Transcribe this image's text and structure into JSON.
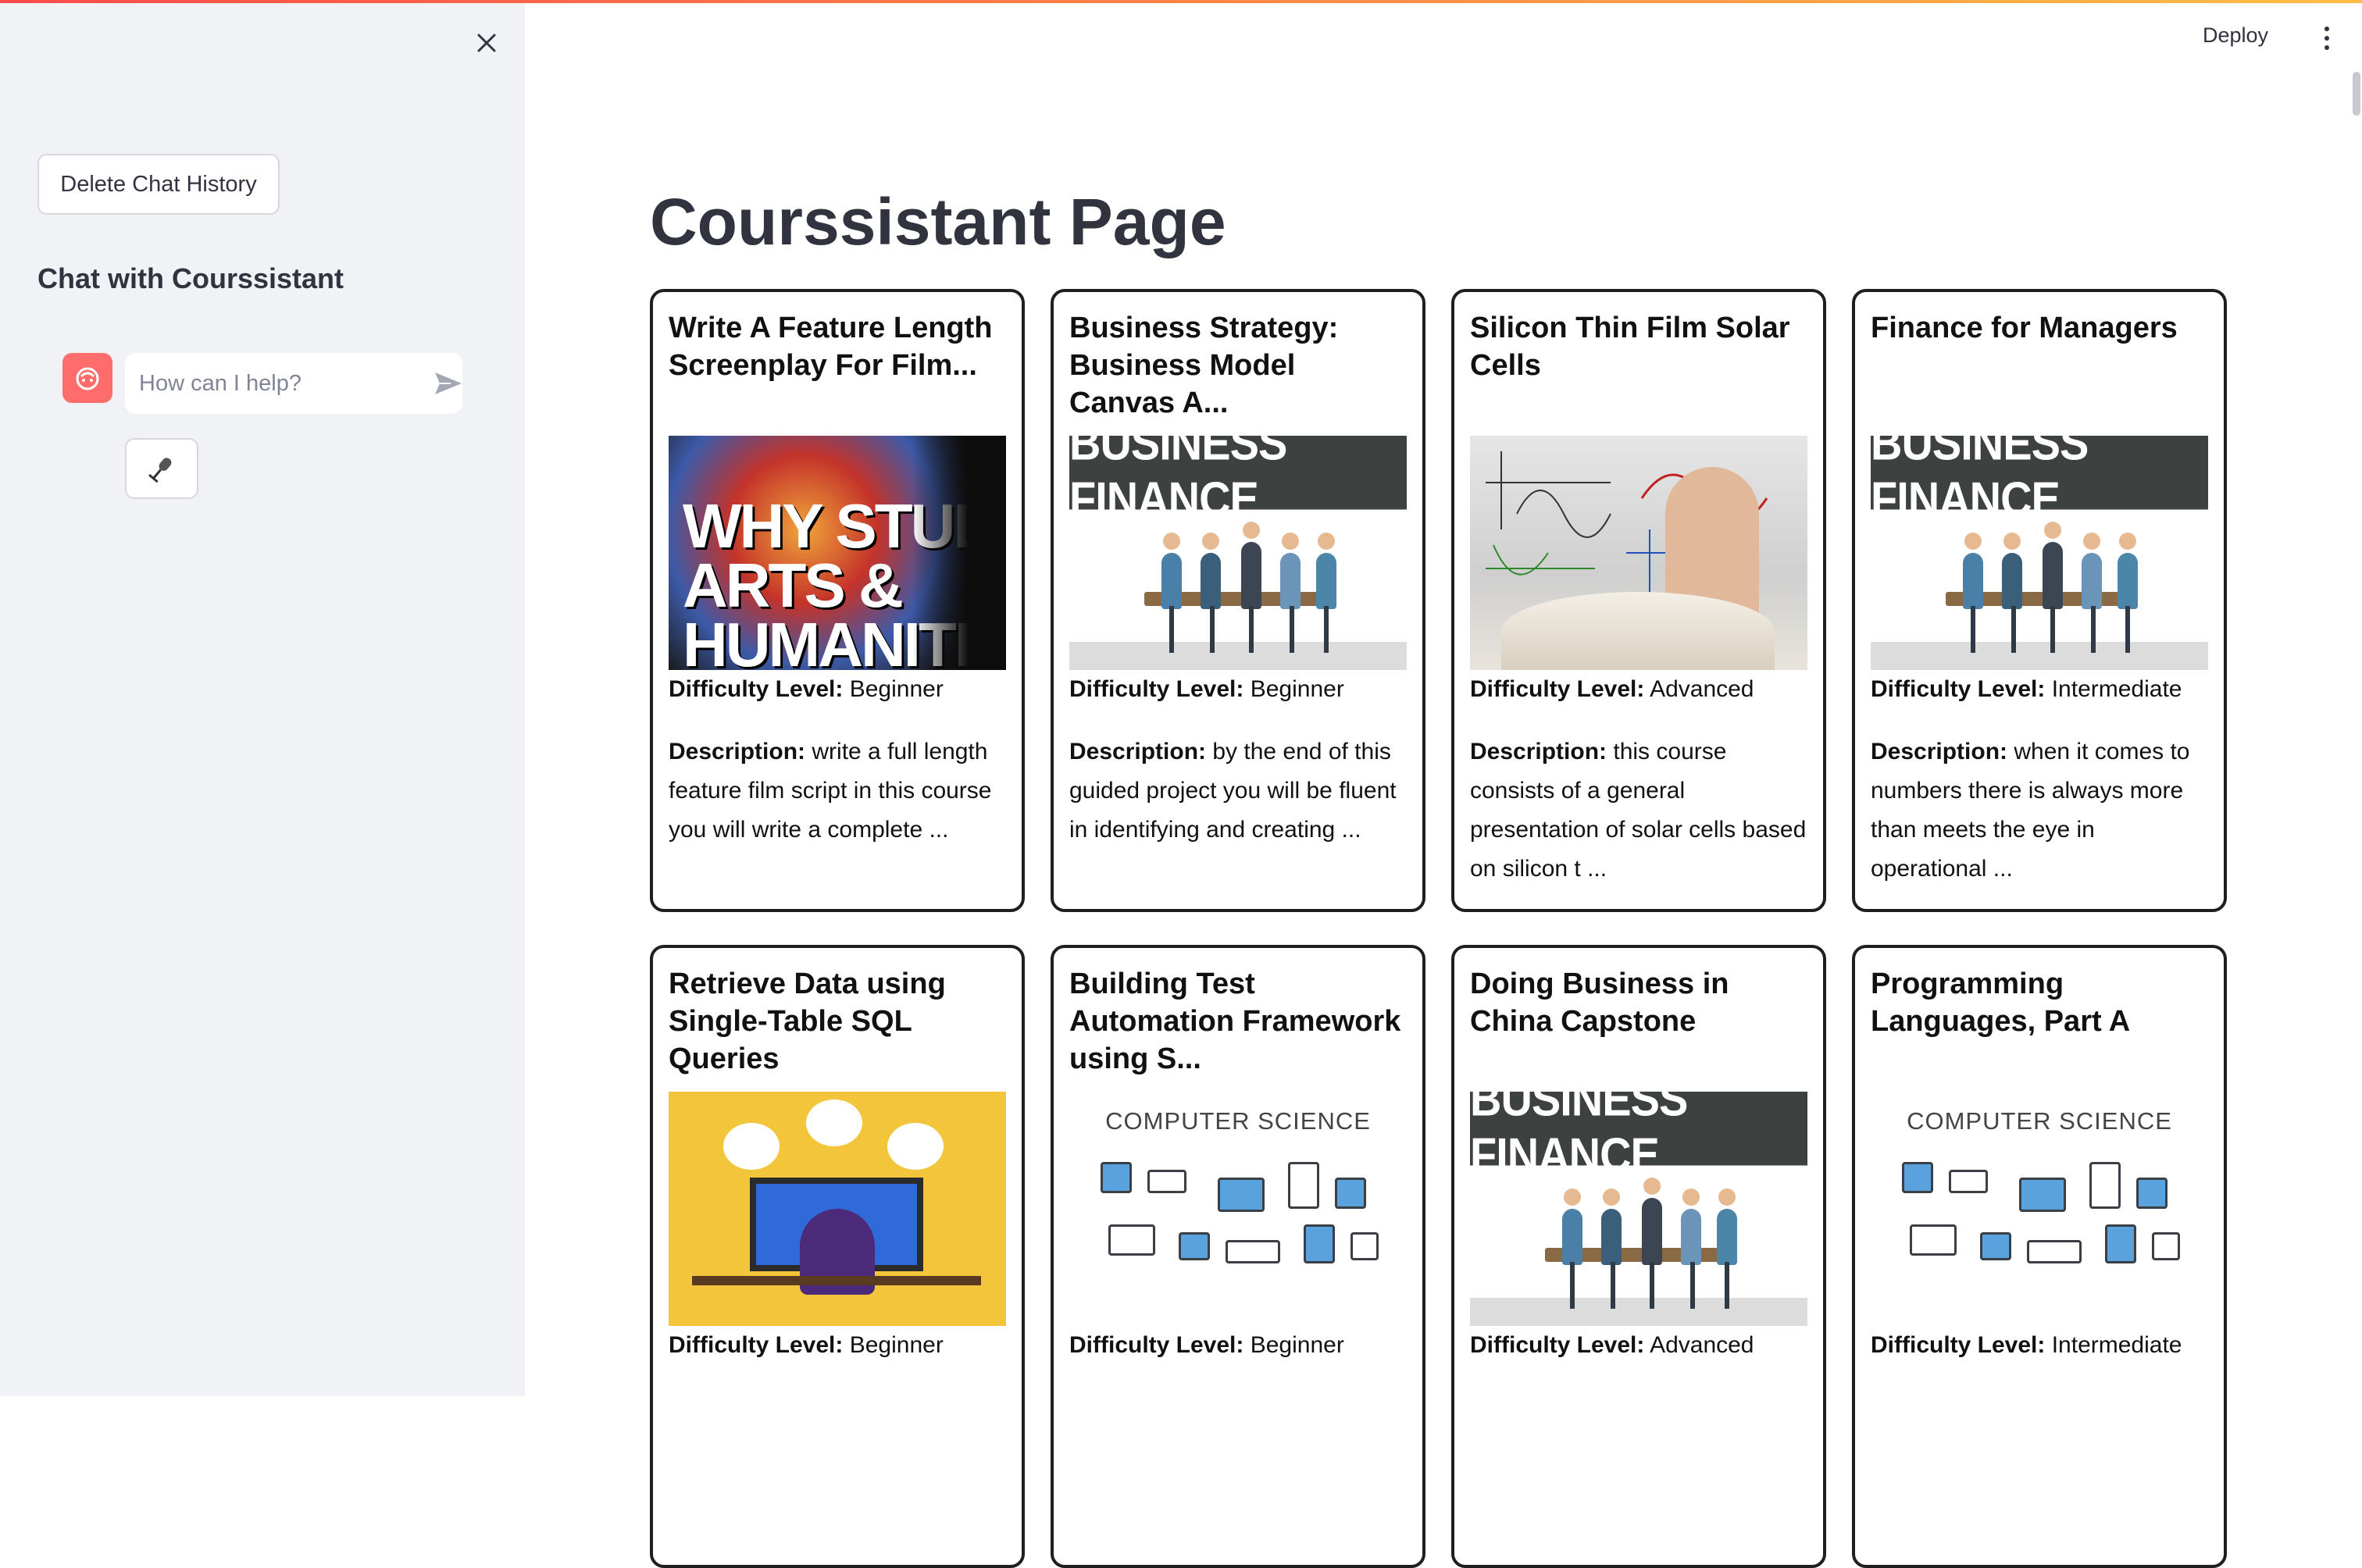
{
  "sidebar": {
    "delete_label": "Delete Chat History",
    "chat_heading": "Chat with Courssistant",
    "chat_placeholder": "How can I help?"
  },
  "header": {
    "deploy_label": "Deploy"
  },
  "main": {
    "title": "Courssistant Page",
    "difficulty_label": "Difficulty Level:",
    "description_label": "Description:",
    "cards": [
      {
        "title": "Write A Feature Length Screenplay For Film...",
        "image": "arts-humanities",
        "image_text": "WHY STUDY ARTS & HUMANITIES?",
        "difficulty": "Beginner",
        "description": "write a full length feature film script in this course you will write a complete ..."
      },
      {
        "title": "Business Strategy: Business Model Canvas A...",
        "image": "business-finance",
        "image_text": "BUSINESS FINANCE",
        "difficulty": "Beginner",
        "description": "by the end of this guided project you will be fluent in identifying and creating ..."
      },
      {
        "title": "Silicon Thin Film Solar Cells",
        "image": "physical-science",
        "difficulty": "Advanced",
        "description": "this course consists of a general presentation of solar cells based on silicon t ..."
      },
      {
        "title": "Finance for Managers",
        "image": "business-finance",
        "image_text": "BUSINESS FINANCE",
        "difficulty": "Intermediate",
        "description": "when it comes to numbers there is always more than meets the eye in operational ..."
      },
      {
        "title": "Retrieve Data using Single-Table SQL Queries",
        "image": "data-science",
        "difficulty": "Beginner"
      },
      {
        "title": "Building Test Automation Framework using S...",
        "image": "computer-science",
        "image_text": "COMPUTER SCIENCE",
        "difficulty": "Beginner"
      },
      {
        "title": "Doing Business in China Capstone",
        "image": "business-finance",
        "image_text": "BUSINESS FINANCE",
        "difficulty": "Advanced"
      },
      {
        "title": "Programming Languages, Part A",
        "image": "computer-science",
        "image_text": "COMPUTER SCIENCE",
        "difficulty": "Intermediate"
      }
    ]
  },
  "icons": {
    "close": "close-icon",
    "avatar": "robot-avatar-icon",
    "send": "send-icon",
    "mic": "microphone-icon",
    "menu": "kebab-menu-icon"
  },
  "colors": {
    "sidebar_bg": "#f0f2f6",
    "avatar_bg": "#ff6c6c",
    "card_border": "#1f1f1f",
    "text": "#31333f"
  }
}
